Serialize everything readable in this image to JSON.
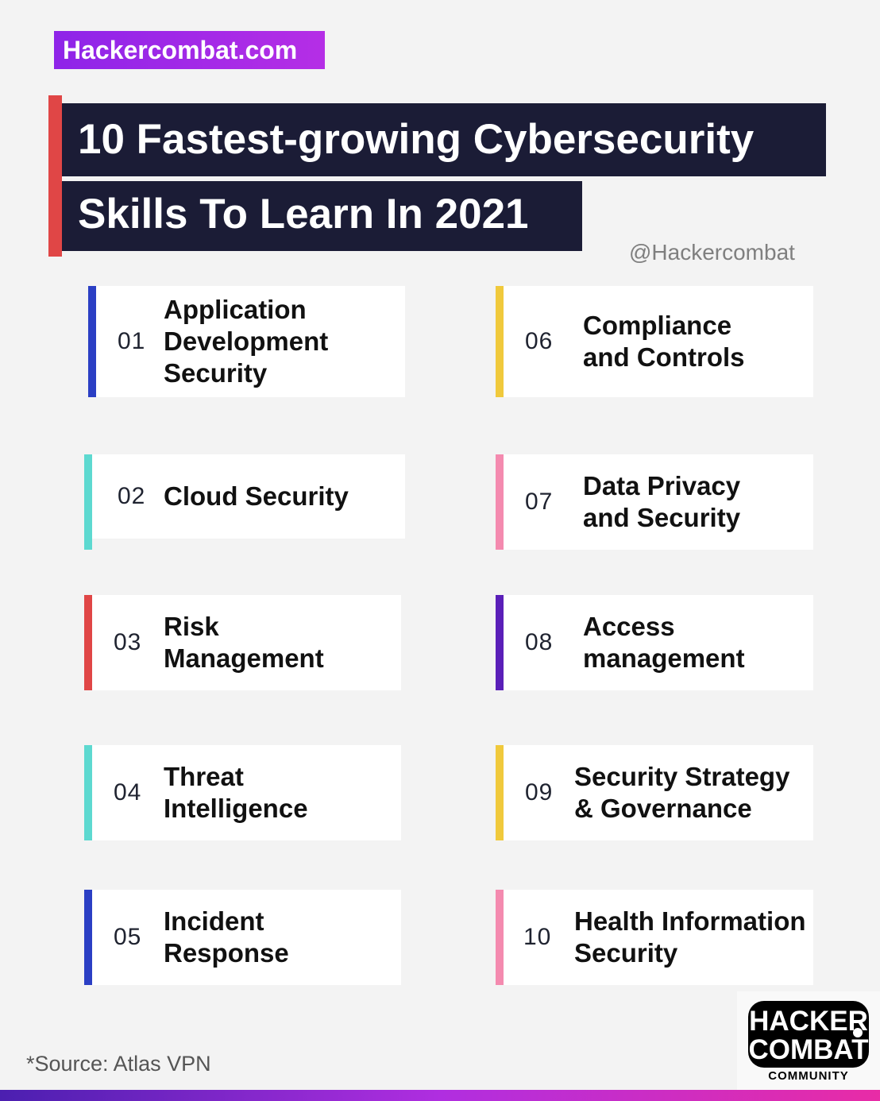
{
  "brand": {
    "site": "Hackercombat.com"
  },
  "title": {
    "line1": "10 Fastest-growing Cybersecurity",
    "line2": "Skills To Learn In 2021",
    "accent_color": "#e04646"
  },
  "handle": "@Hackercombat",
  "skills": [
    {
      "number": "01",
      "label": "Application\nDevelopment\nSecurity",
      "color": "#2b3fc4"
    },
    {
      "number": "02",
      "label": "Cloud Security",
      "color": "#5dd9d0"
    },
    {
      "number": "03",
      "label": "Risk\nManagement",
      "color": "#e04646"
    },
    {
      "number": "04",
      "label": "Threat\nIntelligence",
      "color": "#5dd9d0"
    },
    {
      "number": "05",
      "label": "Incident\nResponse",
      "color": "#2b3fc4"
    },
    {
      "number": "06",
      "label": "Compliance\nand Controls",
      "color": "#f0c93c"
    },
    {
      "number": "07",
      "label": "Data Privacy\nand Security",
      "color": "#f48aaf"
    },
    {
      "number": "08",
      "label": "Access\nmanagement",
      "color": "#5a1fb8"
    },
    {
      "number": "09",
      "label": "Security Strategy\n& Governance",
      "color": "#f0c93c"
    },
    {
      "number": "10",
      "label": "Health Information\nSecurity",
      "color": "#f48aaf"
    }
  ],
  "source": "*Source: Atlas VPN",
  "logo": {
    "line1": "HACKER",
    "line2": "COMBAT",
    "sub": "COMMUNITY"
  }
}
